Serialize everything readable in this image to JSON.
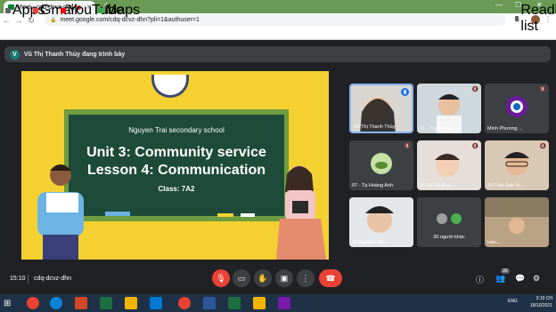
{
  "browser": {
    "tab_title": "Meet - cdq-dcvz-dhn",
    "tab_close": "✕",
    "new_tab": "+",
    "url": "meet.google.com/cdq-dcvz-dhn?pli=1&authuser=1",
    "win_min": "—",
    "win_max": "☐",
    "win_close": "✕"
  },
  "bookmarks": [
    "Apps",
    "Gmail",
    "YouTube",
    "Maps"
  ],
  "reading_list": "Reading list",
  "presenting": {
    "avatar": "V",
    "text": "Vũ Thị Thanh Thủy đang trình bày"
  },
  "slide": {
    "school": "Nguyen Trai secondary school",
    "unit": "Unit 3: Community service",
    "lesson": "Lesson 4: Communication",
    "class": "Class: 7A2"
  },
  "participants": [
    {
      "name": "Vũ Thị Thanh Thủy"
    },
    {
      "name": "01 - Trương H..."
    },
    {
      "name": "Minh Phương ..."
    },
    {
      "name": "07 - Tạ Hoàng Anh"
    },
    {
      "name": "11-Lê Thị Khá..."
    },
    {
      "name": "24-Trần Bảo N..."
    },
    {
      "name": "19-Nguyễn Bả..."
    },
    {
      "name": "30 người khác"
    },
    {
      "name": "Han..."
    }
  ],
  "meeting": {
    "time": "15:10",
    "code": "cdq-dcvz-dhn",
    "people_count": "39"
  },
  "taskbar": {
    "time": "3:10 CH",
    "date": "18/10/2021",
    "lang": "ENG"
  },
  "colors": {
    "accent": "#1a73e8",
    "danger": "#ea4335",
    "slide_bg": "#f4d130",
    "board": "#1e4a3a"
  }
}
